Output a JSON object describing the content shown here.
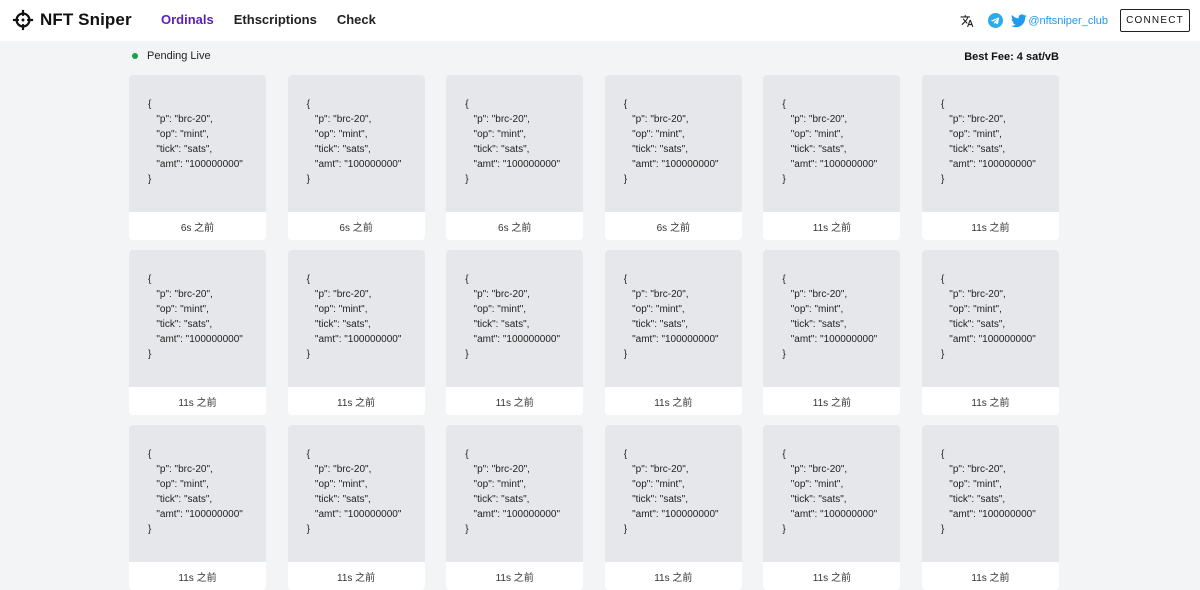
{
  "brand": {
    "name": "NFT Sniper",
    "icon": "crosshair-icon"
  },
  "nav": {
    "items": [
      {
        "label": "Ordinals",
        "active": true
      },
      {
        "label": "Ethscriptions",
        "active": false
      },
      {
        "label": "Check",
        "active": false
      }
    ]
  },
  "header_right": {
    "translate_icon": "translate-icon",
    "telegram_icon": "telegram-icon",
    "twitter_icon": "twitter-icon",
    "twitter_handle": "@nftsniper_club",
    "connect_label": "CONNECT"
  },
  "status": {
    "label": "Pending Live",
    "indicator_color": "#16a34a",
    "best_fee": "Best Fee: 4 sat/vB"
  },
  "colors": {
    "accent": "#5b21b6",
    "twitter": "#1d9bf0",
    "telegram": "#2aabee",
    "card_body": "#e5e7eb",
    "page_bg": "#f3f4f6"
  },
  "cards": [
    {
      "content": "{\n   \"p\": \"brc-20\",\n   \"op\": \"mint\",\n   \"tick\": \"sats\",\n   \"amt\": \"100000000\"\n}",
      "time": "6s 之前"
    },
    {
      "content": "{\n   \"p\": \"brc-20\",\n   \"op\": \"mint\",\n   \"tick\": \"sats\",\n   \"amt\": \"100000000\"\n}",
      "time": "6s 之前"
    },
    {
      "content": "{\n   \"p\": \"brc-20\",\n   \"op\": \"mint\",\n   \"tick\": \"sats\",\n   \"amt\": \"100000000\"\n}",
      "time": "6s 之前"
    },
    {
      "content": "{\n   \"p\": \"brc-20\",\n   \"op\": \"mint\",\n   \"tick\": \"sats\",\n   \"amt\": \"100000000\"\n}",
      "time": "6s 之前"
    },
    {
      "content": "{\n   \"p\": \"brc-20\",\n   \"op\": \"mint\",\n   \"tick\": \"sats\",\n   \"amt\": \"100000000\"\n}",
      "time": "11s 之前"
    },
    {
      "content": "{\n   \"p\": \"brc-20\",\n   \"op\": \"mint\",\n   \"tick\": \"sats\",\n   \"amt\": \"100000000\"\n}",
      "time": "11s 之前"
    },
    {
      "content": "{\n   \"p\": \"brc-20\",\n   \"op\": \"mint\",\n   \"tick\": \"sats\",\n   \"amt\": \"100000000\"\n}",
      "time": "11s 之前"
    },
    {
      "content": "{\n   \"p\": \"brc-20\",\n   \"op\": \"mint\",\n   \"tick\": \"sats\",\n   \"amt\": \"100000000\"\n}",
      "time": "11s 之前"
    },
    {
      "content": "{\n   \"p\": \"brc-20\",\n   \"op\": \"mint\",\n   \"tick\": \"sats\",\n   \"amt\": \"100000000\"\n}",
      "time": "11s 之前"
    },
    {
      "content": "{\n   \"p\": \"brc-20\",\n   \"op\": \"mint\",\n   \"tick\": \"sats\",\n   \"amt\": \"100000000\"\n}",
      "time": "11s 之前"
    },
    {
      "content": "{\n   \"p\": \"brc-20\",\n   \"op\": \"mint\",\n   \"tick\": \"sats\",\n   \"amt\": \"100000000\"\n}",
      "time": "11s 之前"
    },
    {
      "content": "{\n   \"p\": \"brc-20\",\n   \"op\": \"mint\",\n   \"tick\": \"sats\",\n   \"amt\": \"100000000\"\n}",
      "time": "11s 之前"
    },
    {
      "content": "{\n   \"p\": \"brc-20\",\n   \"op\": \"mint\",\n   \"tick\": \"sats\",\n   \"amt\": \"100000000\"\n}",
      "time": "11s 之前"
    },
    {
      "content": "{\n   \"p\": \"brc-20\",\n   \"op\": \"mint\",\n   \"tick\": \"sats\",\n   \"amt\": \"100000000\"\n}",
      "time": "11s 之前"
    },
    {
      "content": "{\n   \"p\": \"brc-20\",\n   \"op\": \"mint\",\n   \"tick\": \"sats\",\n   \"amt\": \"100000000\"\n}",
      "time": "11s 之前"
    },
    {
      "content": "{\n   \"p\": \"brc-20\",\n   \"op\": \"mint\",\n   \"tick\": \"sats\",\n   \"amt\": \"100000000\"\n}",
      "time": "11s 之前"
    },
    {
      "content": "{\n   \"p\": \"brc-20\",\n   \"op\": \"mint\",\n   \"tick\": \"sats\",\n   \"amt\": \"100000000\"\n}",
      "time": "11s 之前"
    },
    {
      "content": "{\n   \"p\": \"brc-20\",\n   \"op\": \"mint\",\n   \"tick\": \"sats\",\n   \"amt\": \"100000000\"\n}",
      "time": "11s 之前"
    }
  ]
}
